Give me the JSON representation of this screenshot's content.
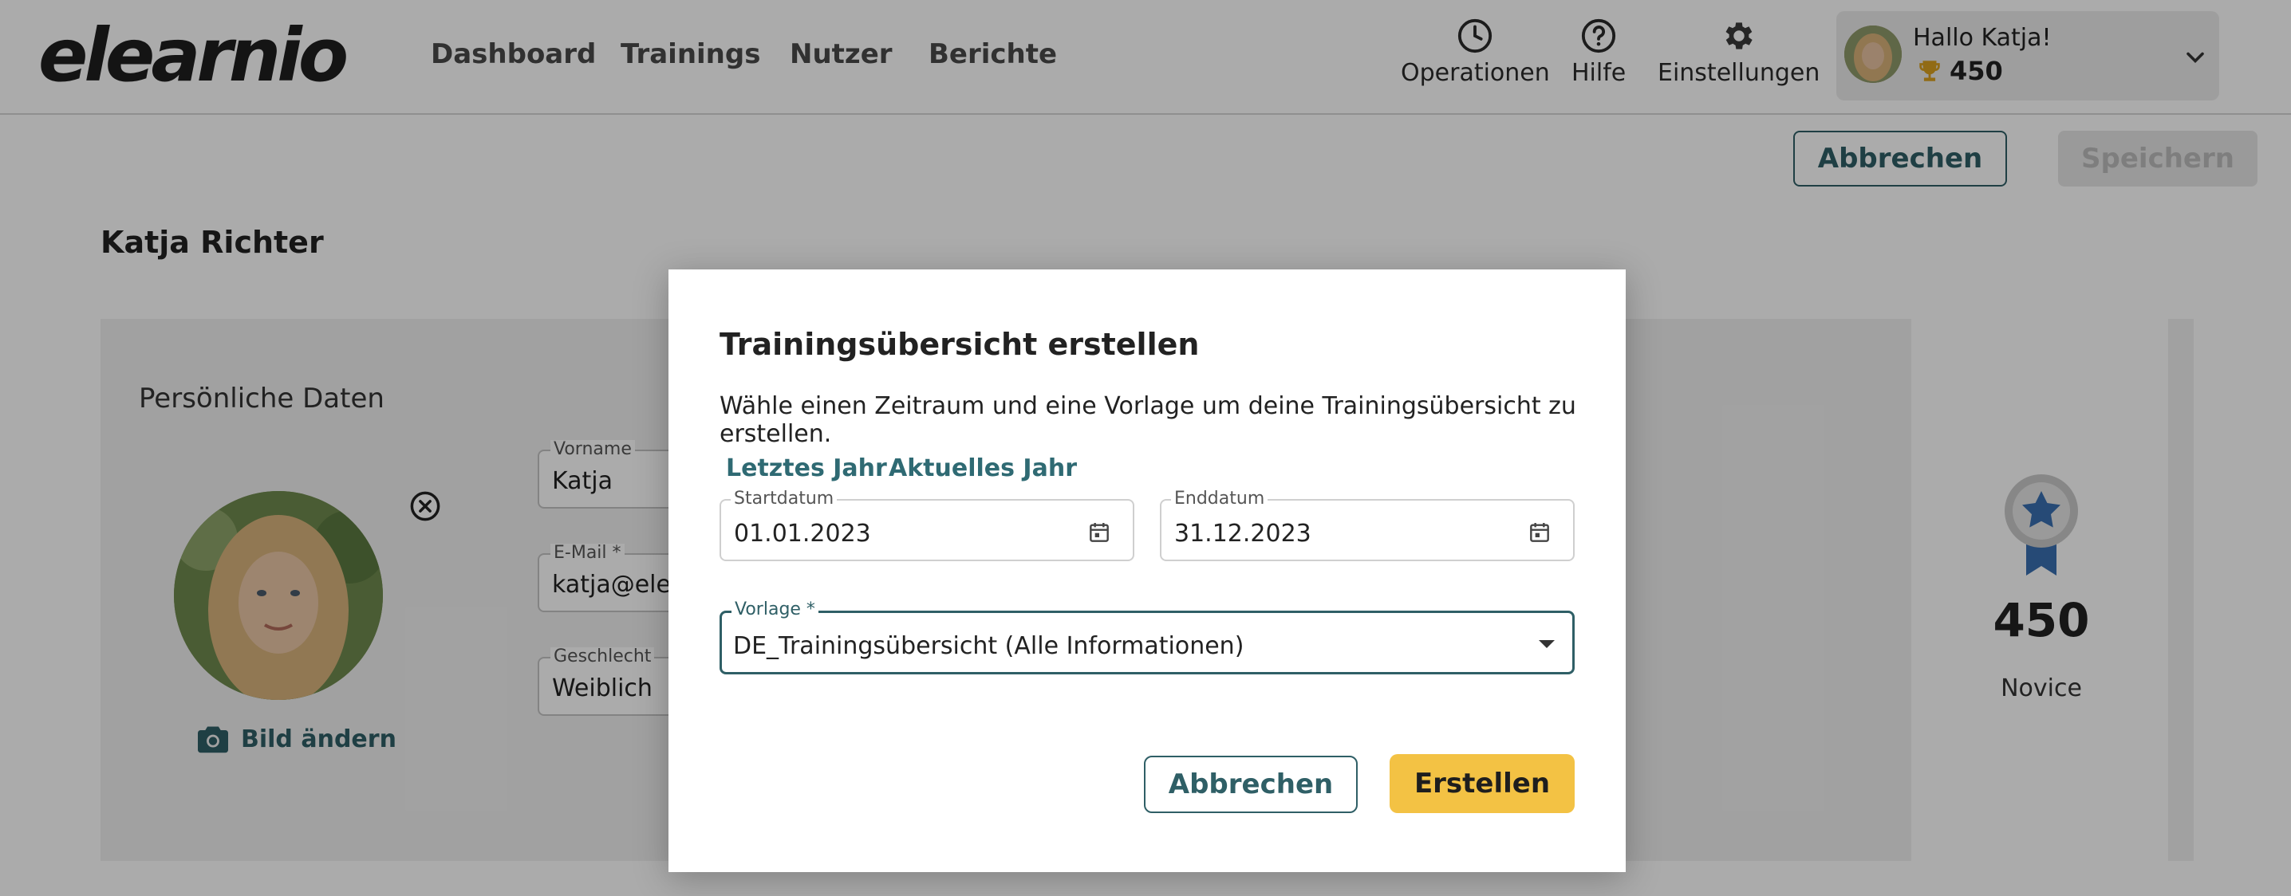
{
  "app": {
    "logo": "elearnio"
  },
  "nav": {
    "items": [
      "Dashboard",
      "Trainings",
      "Nutzer",
      "Berichte"
    ]
  },
  "tools": {
    "operations": "Operationen",
    "help": "Hilfe",
    "settings": "Einstellungen"
  },
  "user": {
    "greeting": "Hallo Katja!",
    "points": "450"
  },
  "page": {
    "cancel_label": "Abbrechen",
    "save_label": "Speichern",
    "title": "Katja Richter"
  },
  "profile": {
    "section_title": "Persönliche Daten",
    "change_picture": "Bild ändern",
    "fields": {
      "first_name": {
        "label": "Vorname",
        "value": "Katja"
      },
      "email": {
        "label": "E-Mail *",
        "value": "katja@elearnio.com"
      },
      "gender": {
        "label": "Geschlecht",
        "value": "Weiblich"
      }
    },
    "score": "450",
    "level": "Novice"
  },
  "dialog": {
    "title": "Trainingsübersicht erstellen",
    "description": "Wähle einen Zeitraum und eine Vorlage um deine Trainingsübersicht zu erstellen.",
    "quick_last_year": "Letztes Jahr",
    "quick_current_year": "Aktuelles Jahr",
    "start": {
      "label": "Startdatum",
      "value": "01.01.2023"
    },
    "end": {
      "label": "Enddatum",
      "value": "31.12.2023"
    },
    "template": {
      "label": "Vorlage *",
      "value": "DE_Trainingsübersicht (Alle Informationen)"
    },
    "cancel_label": "Abbrechen",
    "create_label": "Erstellen"
  },
  "colors": {
    "accent": "#2f5f66",
    "primary_button": "#f3c244",
    "badge_blue": "#3a6fb0"
  }
}
